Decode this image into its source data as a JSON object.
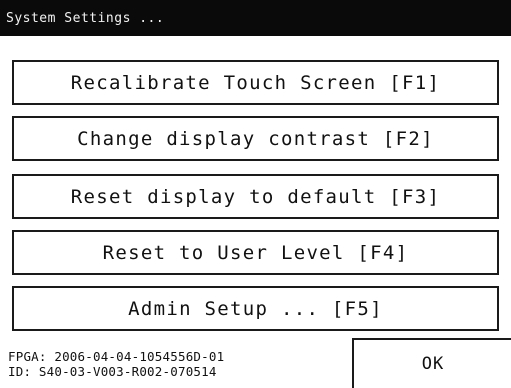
{
  "window": {
    "title": "System Settings ..."
  },
  "buttons": [
    {
      "label": "Recalibrate Touch Screen [F1]"
    },
    {
      "label": "Change display contrast [F2]"
    },
    {
      "label": "Reset display to default [F3]"
    },
    {
      "label": "Reset to User Level [F4]"
    },
    {
      "label": "Admin Setup ... [F5]"
    }
  ],
  "footer": {
    "fpga": "FPGA: 2006-04-04-1054556D-01",
    "id": "ID: S40-03-V003-R002-070514",
    "ok_label": "OK"
  }
}
